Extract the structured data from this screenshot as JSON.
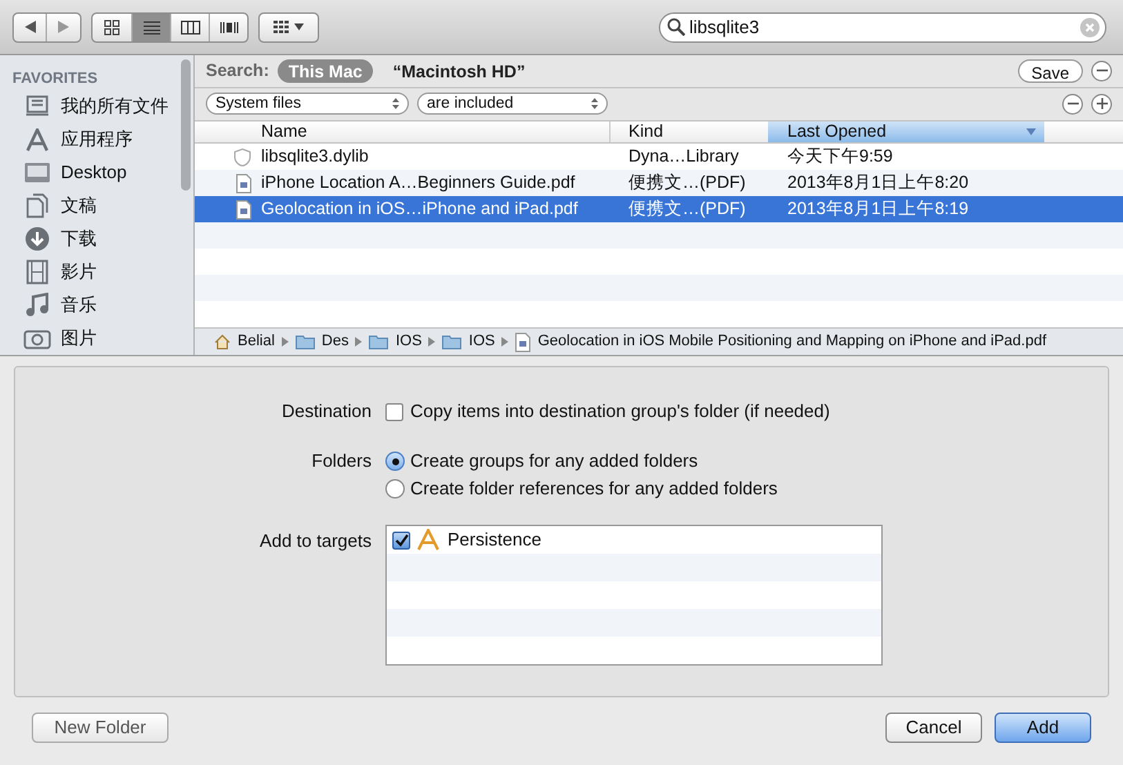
{
  "toolbar": {
    "views": [
      {
        "kind": "icons",
        "selected": false
      },
      {
        "kind": "list",
        "selected": true
      },
      {
        "kind": "columns",
        "selected": false
      },
      {
        "kind": "coverflow",
        "selected": false
      }
    ],
    "search": {
      "value": "libsqlite3"
    }
  },
  "sidebar": {
    "heading": "FAVORITES",
    "items": [
      {
        "kind": "files",
        "label": "我的所有文件"
      },
      {
        "kind": "apps",
        "label": "应用程序"
      },
      {
        "kind": "desktop",
        "label": "Desktop"
      },
      {
        "kind": "docs",
        "label": "文稿"
      },
      {
        "kind": "download",
        "label": "下载"
      },
      {
        "kind": "movies",
        "label": "影片"
      },
      {
        "kind": "music",
        "label": "音乐"
      },
      {
        "kind": "pictures",
        "label": "图片"
      }
    ]
  },
  "search_bar": {
    "label": "Search:",
    "scopes": [
      {
        "label": "This Mac",
        "selected": true
      },
      {
        "label": "“Macintosh HD”",
        "selected": false
      }
    ],
    "save": "Save"
  },
  "filter": {
    "attribute": "System files",
    "condition": "are included"
  },
  "table": {
    "columns": [
      {
        "label": "Name",
        "selected": false
      },
      {
        "label": "Kind",
        "selected": false
      },
      {
        "label": "Last Opened",
        "selected": true
      }
    ],
    "rows": [
      {
        "kind": "library",
        "name": "libsqlite3.dylib",
        "type": "Dyna…Library",
        "date": "今天下午9:59",
        "selected": false
      },
      {
        "kind": "pdf",
        "name": "iPhone Location A…Beginners Guide.pdf",
        "type": "便携文…(PDF)",
        "date": "2013年8月1日上午8:20",
        "selected": false
      },
      {
        "kind": "pdf",
        "name": "Geolocation in iOS…iPhone and iPad.pdf",
        "type": "便携文…(PDF)",
        "date": "2013年8月1日上午8:19",
        "selected": true
      }
    ]
  },
  "path": [
    {
      "kind": "home",
      "label": "Belial"
    },
    {
      "kind": "folder",
      "label": "Des"
    },
    {
      "kind": "folder",
      "label": "IOS"
    },
    {
      "kind": "folder",
      "label": "IOS"
    },
    {
      "kind": "pdf",
      "label": "Geolocation in iOS Mobile Positioning and Mapping on iPhone and iPad.pdf"
    }
  ],
  "options": {
    "destination": {
      "label": "Destination",
      "text": "Copy items into destination group's folder (if needed)",
      "checked": false
    },
    "folders": {
      "label": "Folders",
      "choices": [
        {
          "label": "Create groups for any added folders",
          "selected": true
        },
        {
          "label": "Create folder references for any added folders",
          "selected": false
        }
      ]
    },
    "targets": {
      "label": "Add to targets",
      "items": [
        {
          "label": "Persistence",
          "checked": true
        }
      ]
    }
  },
  "buttons": {
    "new_folder": "New Folder",
    "cancel": "Cancel",
    "add": "Add"
  }
}
